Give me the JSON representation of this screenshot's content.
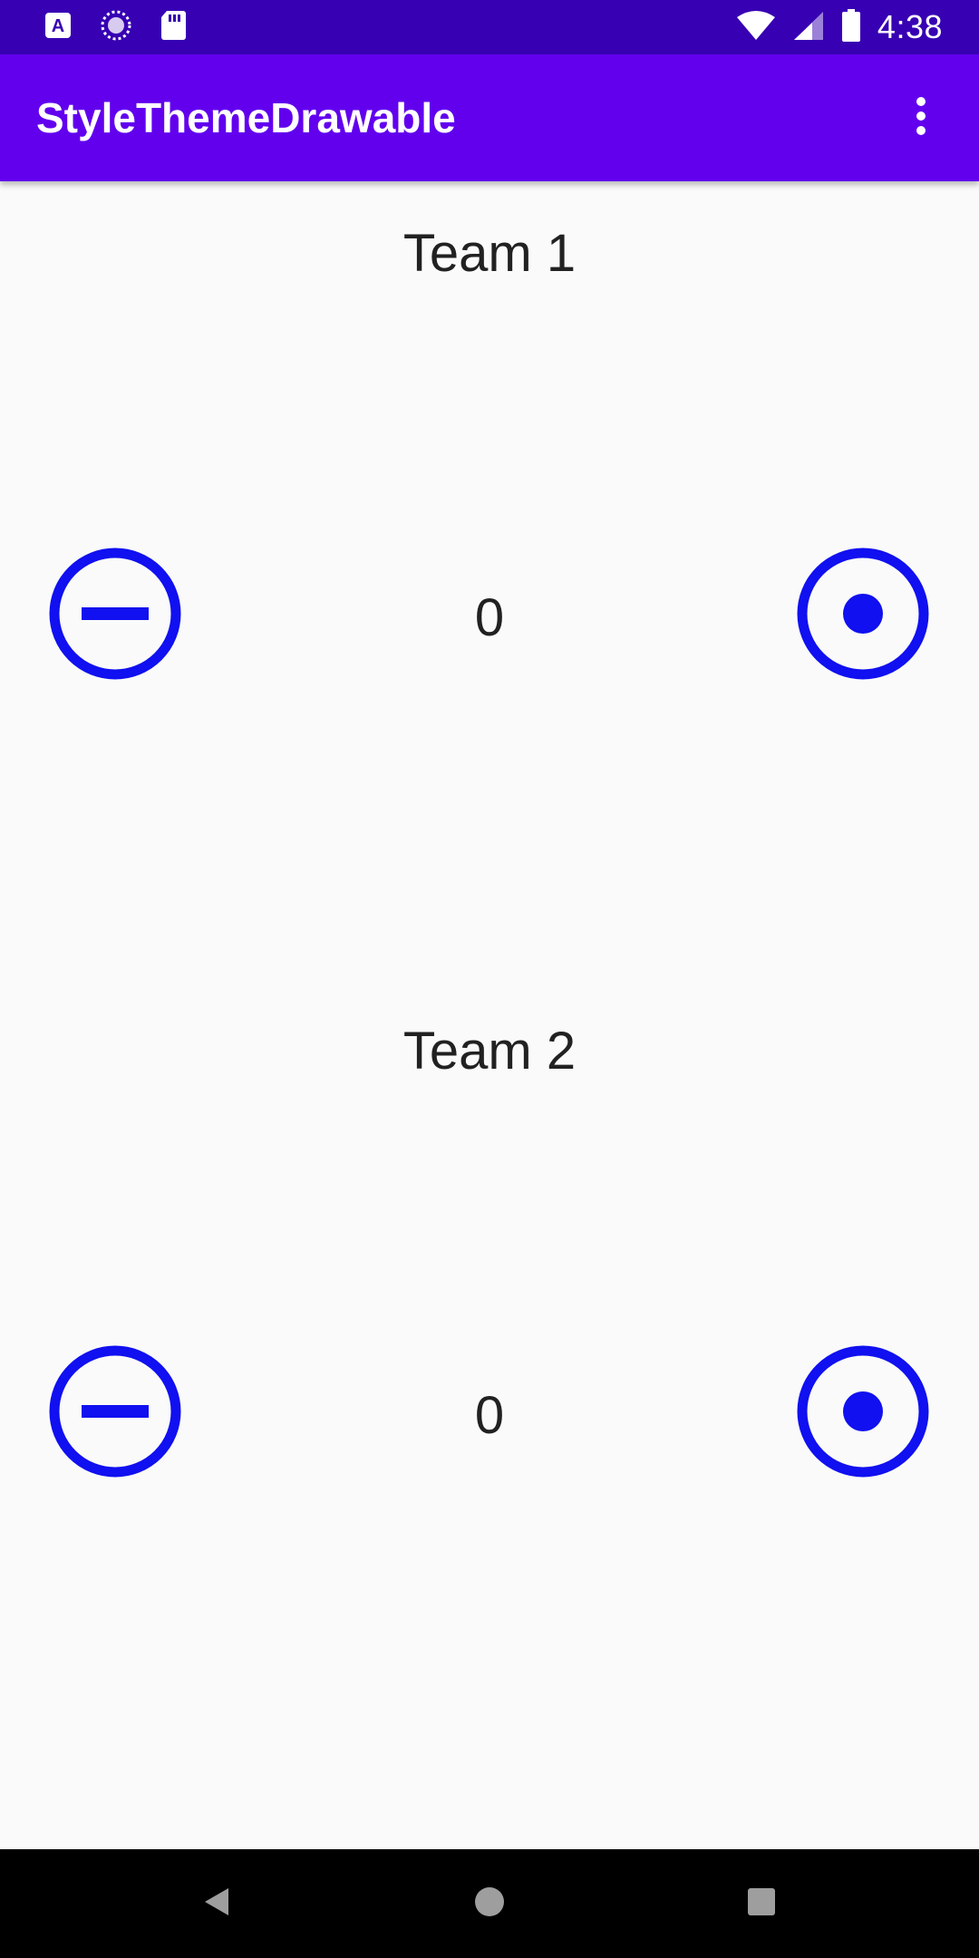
{
  "status_bar": {
    "time": "4:38",
    "icons": [
      "accessibility-a-icon",
      "loading-circle-icon",
      "sd-card-icon",
      "wifi-icon",
      "cell-signal-icon",
      "battery-icon"
    ]
  },
  "app_bar": {
    "title": "StyleThemeDrawable",
    "overflow_icon": "more-vert-icon"
  },
  "teams": [
    {
      "title": "Team 1",
      "score": "0",
      "decrement_icon": "minus-circle-icon",
      "increment_icon": "dot-circle-icon"
    },
    {
      "title": "Team 2",
      "score": "0",
      "decrement_icon": "minus-circle-icon",
      "increment_icon": "dot-circle-icon"
    }
  ],
  "nav_bar": {
    "icons": [
      "back-icon",
      "home-icon",
      "recents-icon"
    ]
  },
  "colors": {
    "status_bar": "#3700b3",
    "app_bar": "#6200ee",
    "button_blue": "#1010f0",
    "background": "#fafafa",
    "text": "#212121"
  }
}
